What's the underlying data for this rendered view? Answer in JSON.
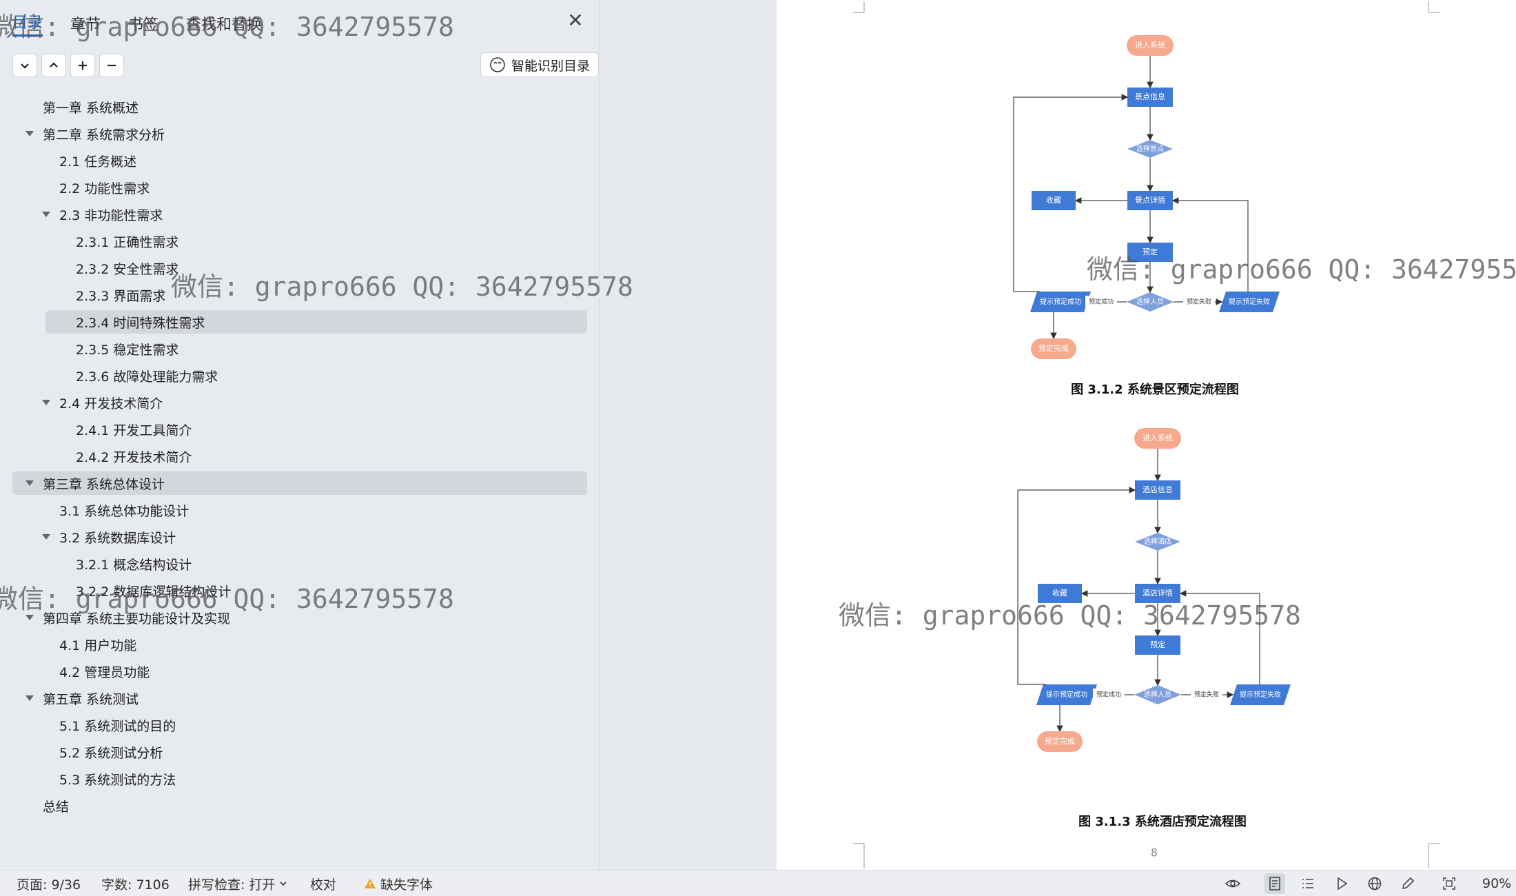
{
  "nav": {
    "tabs": [
      {
        "label": "目录",
        "active": true
      },
      {
        "label": "章节",
        "active": false
      },
      {
        "label": "书签",
        "active": false
      },
      {
        "label": "查找和替换",
        "active": false
      }
    ],
    "smart_toc_label": "智能识别目录",
    "toc": [
      {
        "label": "第一章  系统概述",
        "level": 0,
        "expandable": false,
        "highlighted": false
      },
      {
        "label": "第二章  系统需求分析",
        "level": 0,
        "expandable": true,
        "highlighted": false
      },
      {
        "label": "2.1  任务概述",
        "level": 1,
        "expandable": false,
        "highlighted": false
      },
      {
        "label": "2.2  功能性需求",
        "level": 1,
        "expandable": false,
        "highlighted": false
      },
      {
        "label": "2.3  非功能性需求",
        "level": 1,
        "expandable": true,
        "highlighted": false
      },
      {
        "label": "2.3.1 正确性需求",
        "level": 2,
        "expandable": false,
        "highlighted": false
      },
      {
        "label": "2.3.2 安全性需求",
        "level": 2,
        "expandable": false,
        "highlighted": false
      },
      {
        "label": "2.3.3 界面需求",
        "level": 2,
        "expandable": false,
        "highlighted": false
      },
      {
        "label": "2.3.4 时间特殊性需求",
        "level": 2,
        "expandable": false,
        "highlighted": true
      },
      {
        "label": "2.3.5 稳定性需求",
        "level": 2,
        "expandable": false,
        "highlighted": false
      },
      {
        "label": "2.3.6 故障处理能力需求",
        "level": 2,
        "expandable": false,
        "highlighted": false
      },
      {
        "label": "2.4  开发技术简介",
        "level": 1,
        "expandable": true,
        "highlighted": false
      },
      {
        "label": "2.4.1  开发工具简介",
        "level": 2,
        "expandable": false,
        "highlighted": false
      },
      {
        "label": "2.4.2  开发技术简介",
        "level": 2,
        "expandable": false,
        "highlighted": false
      },
      {
        "label": "第三章  系统总体设计",
        "level": 0,
        "expandable": true,
        "highlighted": true
      },
      {
        "label": "3.1  系统总体功能设计",
        "level": 1,
        "expandable": false,
        "highlighted": false
      },
      {
        "label": "3.2  系统数据库设计",
        "level": 1,
        "expandable": true,
        "highlighted": false
      },
      {
        "label": "3.2.1  概念结构设计",
        "level": 2,
        "expandable": false,
        "highlighted": false
      },
      {
        "label": "3.2.2  数据库逻辑结构设计",
        "level": 2,
        "expandable": false,
        "highlighted": false
      },
      {
        "label": "第四章  系统主要功能设计及实现",
        "level": 0,
        "expandable": true,
        "highlighted": false
      },
      {
        "label": "4.1 用户功能",
        "level": 1,
        "expandable": false,
        "highlighted": false
      },
      {
        "label": "4.2 管理员功能",
        "level": 1,
        "expandable": false,
        "highlighted": false
      },
      {
        "label": "第五章  系统测试",
        "level": 0,
        "expandable": true,
        "highlighted": false
      },
      {
        "label": "5.1  系统测试的目的",
        "level": 1,
        "expandable": false,
        "highlighted": false
      },
      {
        "label": "5.2  系统测试分析",
        "level": 1,
        "expandable": false,
        "highlighted": false
      },
      {
        "label": "5.3  系统测试的方法",
        "level": 1,
        "expandable": false,
        "highlighted": false
      },
      {
        "label": "总结",
        "level": 0,
        "expandable": false,
        "highlighted": false
      }
    ]
  },
  "document": {
    "diagram1": {
      "caption": "图 3.1.2 系统景区预定流程图",
      "nodes": {
        "start": "进入系统",
        "info": "景点信息",
        "select": "选择景点",
        "detail": "景点详情",
        "fav": "收藏",
        "book": "预定",
        "decision": "选择人员",
        "ok": "提示预定成功",
        "fail": "提示预定失败",
        "done": "预定完成"
      },
      "edge_labels": {
        "success": "预定成功",
        "failure": "预定失败"
      }
    },
    "diagram2": {
      "caption": "图 3.1.3 系统酒店预定流程图",
      "nodes": {
        "start": "进入系统",
        "info": "酒店信息",
        "select": "选择酒店",
        "detail": "酒店详情",
        "fav": "收藏",
        "book": "预定",
        "decision": "选择人员",
        "ok": "提示预定成功",
        "fail": "提示预定失败",
        "done": "预定完成"
      },
      "edge_labels": {
        "success": "预定成功",
        "failure": "预定失败"
      }
    },
    "page_number": "8"
  },
  "status_bar": {
    "page": "页面: 9/36",
    "words": "字数: 7106",
    "spellcheck": "拼写检查: 打开",
    "proofread": "校对",
    "missing_fonts": "缺失字体",
    "zoom": "90%"
  },
  "watermark": "微信: grapro666 QQ: 3642795578",
  "colors": {
    "accent": "#1a66d6",
    "flow_process": "#3f7ad6",
    "flow_decision": "#7f9fdd",
    "flow_terminal": "#f6a98c"
  }
}
